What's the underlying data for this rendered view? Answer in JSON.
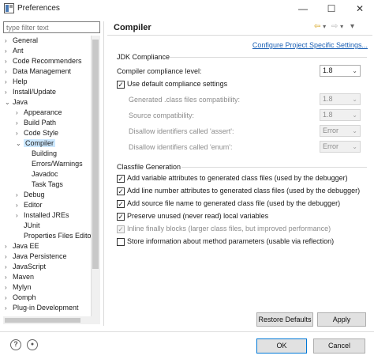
{
  "window": {
    "title": "Preferences"
  },
  "filter": {
    "placeholder": "type filter text"
  },
  "tree": {
    "items": [
      {
        "label": "General",
        "arrow": "›"
      },
      {
        "label": "Ant",
        "arrow": "›"
      },
      {
        "label": "Code Recommenders",
        "arrow": "›"
      },
      {
        "label": "Data Management",
        "arrow": "›"
      },
      {
        "label": "Help",
        "arrow": "›"
      },
      {
        "label": "Install/Update",
        "arrow": "›"
      },
      {
        "label": "Java",
        "arrow": "⌄"
      },
      {
        "label": "Appearance",
        "arrow": "›"
      },
      {
        "label": "Build Path",
        "arrow": "›"
      },
      {
        "label": "Code Style",
        "arrow": "›"
      },
      {
        "label": "Compiler",
        "arrow": "⌄"
      },
      {
        "label": "Building",
        "arrow": ""
      },
      {
        "label": "Errors/Warnings",
        "arrow": ""
      },
      {
        "label": "Javadoc",
        "arrow": ""
      },
      {
        "label": "Task Tags",
        "arrow": ""
      },
      {
        "label": "Debug",
        "arrow": "›"
      },
      {
        "label": "Editor",
        "arrow": "›"
      },
      {
        "label": "Installed JREs",
        "arrow": "›"
      },
      {
        "label": "JUnit",
        "arrow": ""
      },
      {
        "label": "Properties Files Edito",
        "arrow": ""
      },
      {
        "label": "Java EE",
        "arrow": "›"
      },
      {
        "label": "Java Persistence",
        "arrow": "›"
      },
      {
        "label": "JavaScript",
        "arrow": "›"
      },
      {
        "label": "Maven",
        "arrow": "›"
      },
      {
        "label": "Mylyn",
        "arrow": "›"
      },
      {
        "label": "Oomph",
        "arrow": "›"
      },
      {
        "label": "Plug-in Development",
        "arrow": "›"
      }
    ]
  },
  "page": {
    "title": "Compiler",
    "config_link": "Configure Project Specific Settings..."
  },
  "jdk": {
    "group_label": "JDK Compliance",
    "compliance_label": "Compiler compliance level:",
    "compliance_value": "1.8",
    "use_default_label": "Use default compliance settings",
    "use_default_checked": "✓",
    "rows": [
      {
        "label": "Generated .class files compatibility:",
        "value": "1.8"
      },
      {
        "label": "Source compatibility:",
        "value": "1.8"
      },
      {
        "label": "Disallow identifiers called 'assert':",
        "value": "Error"
      },
      {
        "label": "Disallow identifiers called 'enum':",
        "value": "Error"
      }
    ]
  },
  "classfile": {
    "group_label": "Classfile Generation",
    "options": [
      {
        "label": "Add variable attributes to generated class files (used by the debugger)",
        "check": "✓"
      },
      {
        "label": "Add line number attributes to generated class files (used by the debugger)",
        "check": "✓"
      },
      {
        "label": "Add source file name to generated class file (used by the debugger)",
        "check": "✓"
      },
      {
        "label": "Preserve unused (never read) local variables",
        "check": "✓"
      },
      {
        "label": "Inline finally blocks (larger class files, but improved performance)",
        "check": "✓"
      },
      {
        "label": "Store information about method parameters (usable via reflection)",
        "check": ""
      }
    ]
  },
  "buttons": {
    "restore_defaults": "Restore Defaults",
    "apply": "Apply",
    "ok": "OK",
    "cancel": "Cancel"
  },
  "icons": {
    "help": "?",
    "prefs": "●",
    "minimize": "—",
    "maximize": "☐",
    "close": "✕",
    "back": "⇦",
    "forward": "⇨",
    "menu": "▾",
    "caret": "⌄"
  },
  "colors": {
    "selection": "#cce8ff",
    "link": "#1a5fb4",
    "default_button_border": "#0078d7"
  }
}
